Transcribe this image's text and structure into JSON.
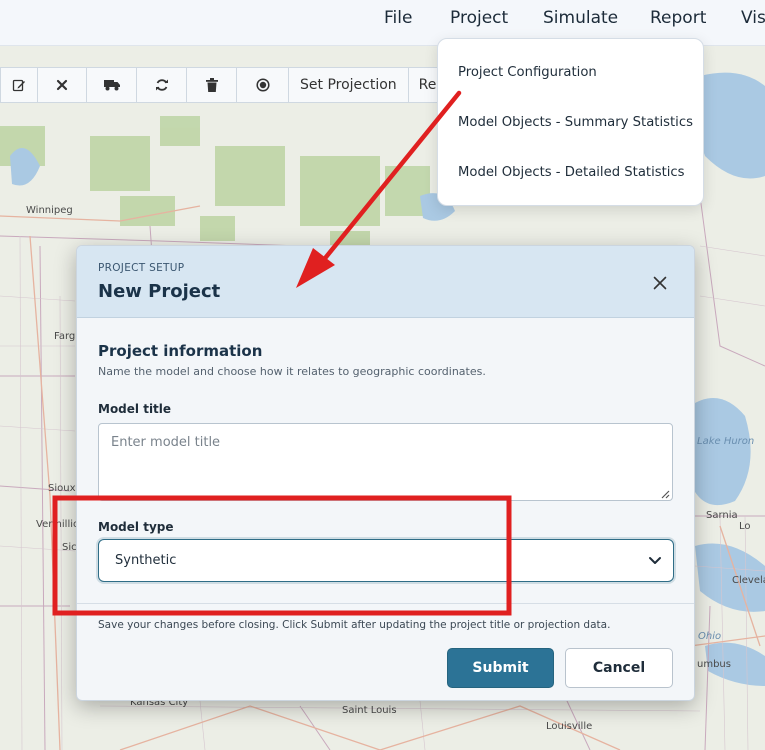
{
  "menu": {
    "items": [
      "File",
      "Project",
      "Simulate",
      "Report",
      "Vis"
    ]
  },
  "toolbar": {
    "icons": [
      "edit-icon",
      "close-icon",
      "truck-icon",
      "refresh-icon",
      "trash-icon",
      "record-icon"
    ],
    "set_projection": "Set Projection",
    "reset": "Rese"
  },
  "project_menu": {
    "items": [
      "Project Configuration",
      "Model Objects - Summary Statistics",
      "Model Objects - Detailed Statistics"
    ]
  },
  "map": {
    "labels": {
      "winnipeg": "Winnipeg",
      "fargo": "Farg",
      "sioux": "Sioux",
      "vermillion": "Vermillio",
      "sic": "Sic",
      "lake_huron": "Lake Huron",
      "sarnia": "Sarnia",
      "lon": "Lo",
      "cleveland": "Clevela",
      "ohio": "Ohio",
      "columbus": "umbus",
      "kansas_city": "Kansas City",
      "saint_louis": "Saint Louis",
      "louisville": "Louisville"
    }
  },
  "modal": {
    "eyebrow": "PROJECT SETUP",
    "title": "New Project",
    "section_title": "Project information",
    "section_desc": "Name the model and choose how it relates to geographic coordinates.",
    "model_title_label": "Model title",
    "model_title_value": "",
    "model_title_placeholder": "Enter model title",
    "model_type_label": "Model type",
    "model_type_value": "Synthetic",
    "footer_note": "Save your changes before closing. Click Submit after updating the project title or projection data.",
    "submit_label": "Submit",
    "cancel_label": "Cancel"
  },
  "colors": {
    "accent": "#2c7396",
    "annotation": "#e02020",
    "header_bg": "#d7e6f2"
  }
}
